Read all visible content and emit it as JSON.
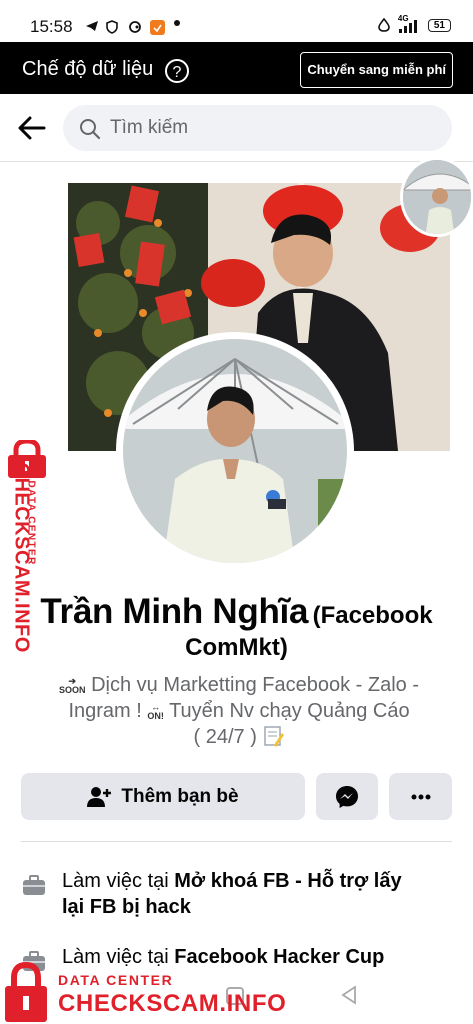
{
  "status_bar": {
    "time": "15:58",
    "network": "4G",
    "battery": "51"
  },
  "data_mode": {
    "title": "Chế độ dữ liệu",
    "switch_label": "Chuyển sang miễn phí"
  },
  "search": {
    "placeholder": "Tìm kiếm"
  },
  "profile": {
    "name": "Trần Minh Nghĩa",
    "alt_name_1": "(Facebook",
    "alt_name_2": "ComMkt)",
    "bio_line1_emoji": "SOON",
    "bio_line1": "Dịch vụ Marketting Facebook - Zalo -",
    "bio_line2_a": "Ingram !",
    "bio_line2_emoji": "ON!",
    "bio_line2_b": "Tuyển Nv chạy Quảng Cáo",
    "bio_line3": "( 24/7 )"
  },
  "actions": {
    "add_friend": "Thêm bạn bè"
  },
  "info": [
    {
      "prefix": "Làm việc tại ",
      "place": "Mở khoá FB -  Hỗ trợ lấy",
      "place_cont": "lại FB bị hack"
    },
    {
      "prefix": "Làm việc tại ",
      "place": "Facebook Hacker Cup"
    }
  ],
  "watermark": {
    "small": "DATA CENTER",
    "big": "CHECKSCAM.INFO"
  },
  "colors": {
    "brand_red": "#e0202a",
    "button_gray": "#e4e6eb",
    "messenger": "#050505"
  }
}
